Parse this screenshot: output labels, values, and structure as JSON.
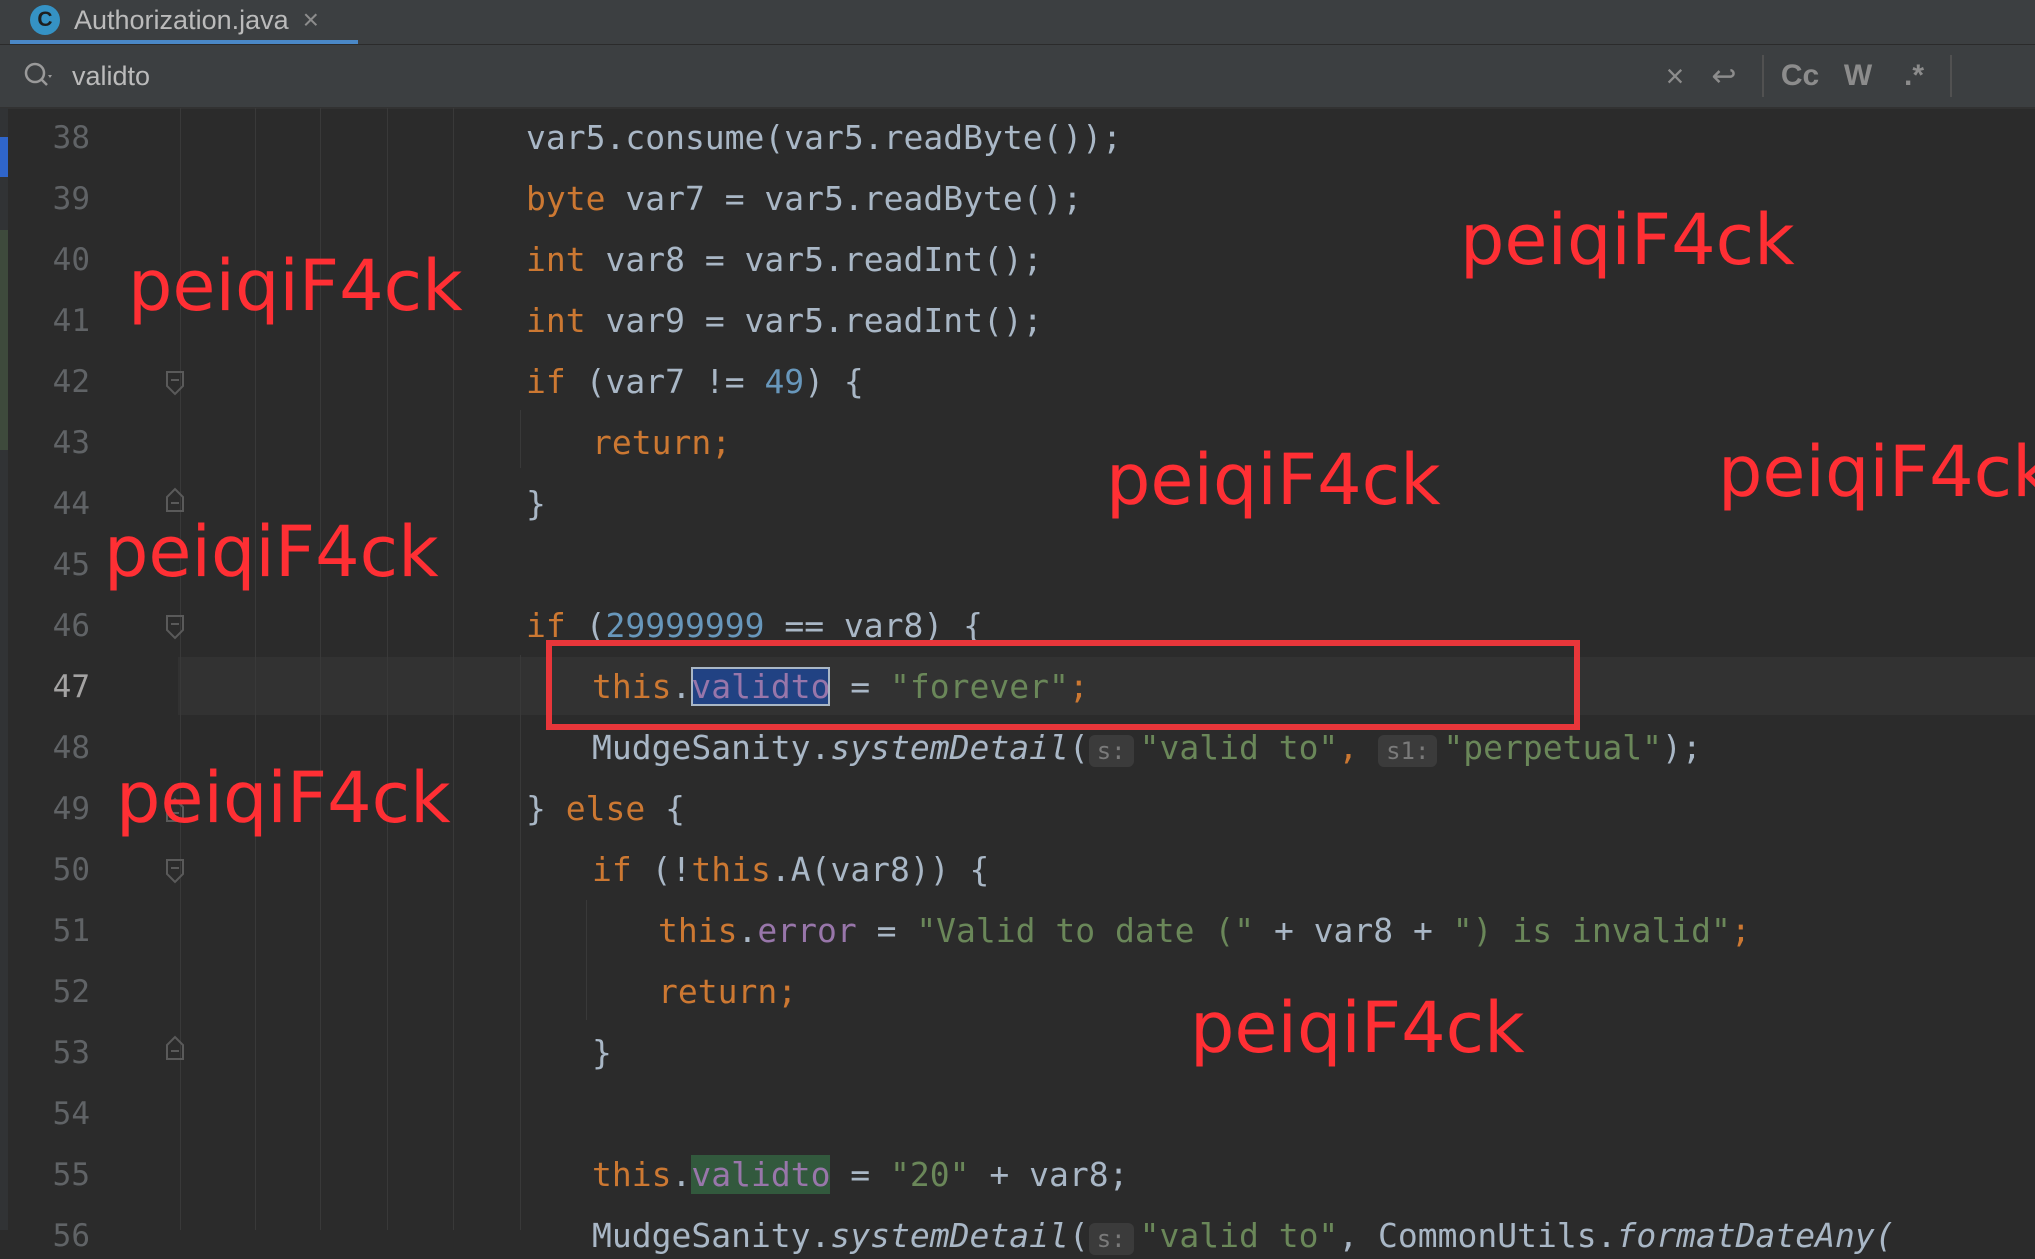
{
  "tab": {
    "icon_letter": "C",
    "title": "Authorization.java",
    "close": "×"
  },
  "search": {
    "value": "validto",
    "clear": "×",
    "wrap": "↩",
    "match_case": "Cc",
    "words": "W",
    "regex": ".*"
  },
  "line_numbers": [
    "38",
    "39",
    "40",
    "41",
    "42",
    "43",
    "44",
    "45",
    "46",
    "47",
    "48",
    "49",
    "50",
    "51",
    "52",
    "53",
    "54",
    "55",
    "56"
  ],
  "code": {
    "l38": {
      "a": "var5.consume(var5.readByte());"
    },
    "l39": {
      "kw": "byte",
      "rest": " var7 = var5.readByte();"
    },
    "l40": {
      "kw": "int",
      "rest": " var8 = var5.readInt();"
    },
    "l41": {
      "kw": "int",
      "rest": " var9 = var5.readInt();"
    },
    "l42": {
      "kw": "if",
      "pre": " (var7 != ",
      "num": "49",
      "post": ") {"
    },
    "l43": {
      "kw": "return;"
    },
    "l44": {
      "a": "}"
    },
    "l46": {
      "kw": "if",
      "pre": " (",
      "num": "29999999",
      "post": " == var8) {"
    },
    "l47": {
      "kw": "this",
      "dot": ".",
      "fld": "validto",
      "eq": " = ",
      "str": "\"forever\"",
      "semi": ";"
    },
    "l48": {
      "cls": "MudgeSanity.",
      "meth": "systemDetail",
      "open": "(",
      "hint1": "s:",
      "str1": "\"valid to\"",
      "comma": ", ",
      "hint2": "s1:",
      "str2": "\"perpetual\"",
      "close": ");"
    },
    "l49": {
      "a": "} ",
      "kw": "else",
      "b": " {"
    },
    "l50": {
      "kw": "if",
      "pre": " (!",
      "kw2": "this",
      "post": ".A(var8)) {"
    },
    "l51": {
      "kw": "this",
      "dot": ".",
      "fld": "error",
      "eq": " = ",
      "str": "\"Valid to date (\"",
      "mid": " + var8 + ",
      "str2": "\") is invalid\"",
      "semi": ";"
    },
    "l52": {
      "kw": "return;"
    },
    "l53": {
      "a": "}"
    },
    "l55": {
      "kw": "this",
      "dot": ".",
      "fld": "validto",
      "eq": " = ",
      "str": "\"20\"",
      "rest": " + var8;"
    },
    "l56": {
      "cls": "MudgeSanity.",
      "meth": "systemDetail",
      "open": "(",
      "hint1": "s:",
      "str1": "\"valid to\"",
      "comma": ", CommonUtils.",
      "meth2": "formatDateAny("
    }
  },
  "watermarks": [
    "peiqiF4ck",
    "peiqiF4ck",
    "peiqiF4ck",
    "peiqiF4ck",
    "peiqiF4ck",
    "peiqiF4ck",
    "peiqiF4ck"
  ],
  "colors": {
    "keyword": "#cc7832",
    "string": "#6a8759",
    "number": "#6897bb",
    "field": "#9876aa",
    "annotation_red": "#e8363a"
  }
}
